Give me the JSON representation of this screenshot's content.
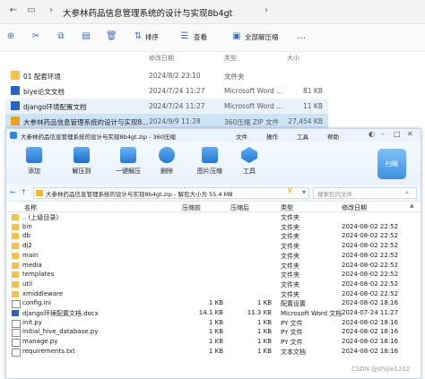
{
  "explorer": {
    "title": "大参林药品信息管理系统的设计与实现8b4gt",
    "commands": {
      "sort": "排序",
      "view": "查看",
      "extract_all": "全部解压缩"
    },
    "columns": {
      "date": "修改日期",
      "type": "类型",
      "size": "大小"
    },
    "files": [
      {
        "name": "01 配套环境",
        "date": "2024/8/2 23:10",
        "type": "文件夹",
        "size": "",
        "icon": "folder-icon"
      },
      {
        "name": "biye论文文档",
        "date": "2024/7/24 11:27",
        "type": "Microsoft Word ...",
        "size": "81 KB",
        "icon": "word-doc-icon"
      },
      {
        "name": "django环境配置文档",
        "date": "2024/7/24 11:27",
        "type": "Microsoft Word ...",
        "size": "11 KB",
        "icon": "word-doc-icon"
      },
      {
        "name": "大参林药品信息管理系统的设计与实现8...",
        "date": "2024/9/9 11:28",
        "type": "360压缩 ZIP 文件",
        "size": "27,454 KB",
        "icon": "zip-icon"
      }
    ]
  },
  "zipwin": {
    "title": "大参林药品信息管理系统的设计与实现8b4gt.zip - 360压缩",
    "menu": [
      "文件",
      "操作",
      "工具",
      "帮助"
    ],
    "toolbar": [
      "添加",
      "解压到",
      "一键解压",
      "删除",
      "图片压缩",
      "工具"
    ],
    "badge": "扫瞄",
    "address": "大参林药品信息管理系统的设计与实现8b4gt.zip - 解包大小为 55.4 MB",
    "search_placeholder": "搜索包内文件",
    "columns": [
      "名称",
      "压缩前",
      "压缩后",
      "类型",
      "修改日期"
    ],
    "rows": [
      {
        "name": ".. (上级目录)",
        "orig": "",
        "comp": "",
        "type": "文件夹",
        "date": "",
        "icon": "folder-up-icon"
      },
      {
        "name": "bin",
        "orig": "",
        "comp": "",
        "type": "文件夹",
        "date": "2024-08-02 22:52",
        "icon": "folder-icon"
      },
      {
        "name": "db",
        "orig": "",
        "comp": "",
        "type": "文件夹",
        "date": "2024-08-02 22:52",
        "icon": "folder-icon"
      },
      {
        "name": "dj2",
        "orig": "",
        "comp": "",
        "type": "文件夹",
        "date": "2024-08-02 22:52",
        "icon": "folder-icon"
      },
      {
        "name": "main",
        "orig": "",
        "comp": "",
        "type": "文件夹",
        "date": "2024-08-02 22:52",
        "icon": "folder-icon"
      },
      {
        "name": "media",
        "orig": "",
        "comp": "",
        "type": "文件夹",
        "date": "2024-08-02 22:52",
        "icon": "folder-icon"
      },
      {
        "name": "templates",
        "orig": "",
        "comp": "",
        "type": "文件夹",
        "date": "2024-08-02 22:52",
        "icon": "folder-icon"
      },
      {
        "name": "util",
        "orig": "",
        "comp": "",
        "type": "文件夹",
        "date": "2024-08-02 22:52",
        "icon": "folder-icon"
      },
      {
        "name": "xmiddleware",
        "orig": "",
        "comp": "",
        "type": "文件夹",
        "date": "2024-08-02 22:52",
        "icon": "folder-icon"
      },
      {
        "name": "config.ini",
        "orig": "1 KB",
        "comp": "1 KB",
        "type": "配置设置",
        "date": "2024-08-02 18:16",
        "icon": "file-icon"
      },
      {
        "name": "django环境配置文档.docx",
        "orig": "14.1 KB",
        "comp": "11.3 KB",
        "type": "Microsoft Word 文档",
        "date": "2024-07-24 11:27",
        "icon": "word-doc-icon"
      },
      {
        "name": "init.py",
        "orig": "1 KB",
        "comp": "1 KB",
        "type": "PY 文件",
        "date": "2024-08-02 18:16",
        "icon": "file-icon"
      },
      {
        "name": "initial_hive_database.py",
        "orig": "1 KB",
        "comp": "1 KB",
        "type": "PY 文件",
        "date": "2024-08-02 18:16",
        "icon": "file-icon"
      },
      {
        "name": "manage.py",
        "orig": "1 KB",
        "comp": "1 KB",
        "type": "PY 文件",
        "date": "2024-08-02 18:16",
        "icon": "file-icon"
      },
      {
        "name": "requirements.txt",
        "orig": "1 KB",
        "comp": "1 KB",
        "type": "文本文档",
        "date": "2024-08-02 18:16",
        "icon": "file-icon"
      }
    ]
  },
  "watermark": "CSDN @shijie1102"
}
